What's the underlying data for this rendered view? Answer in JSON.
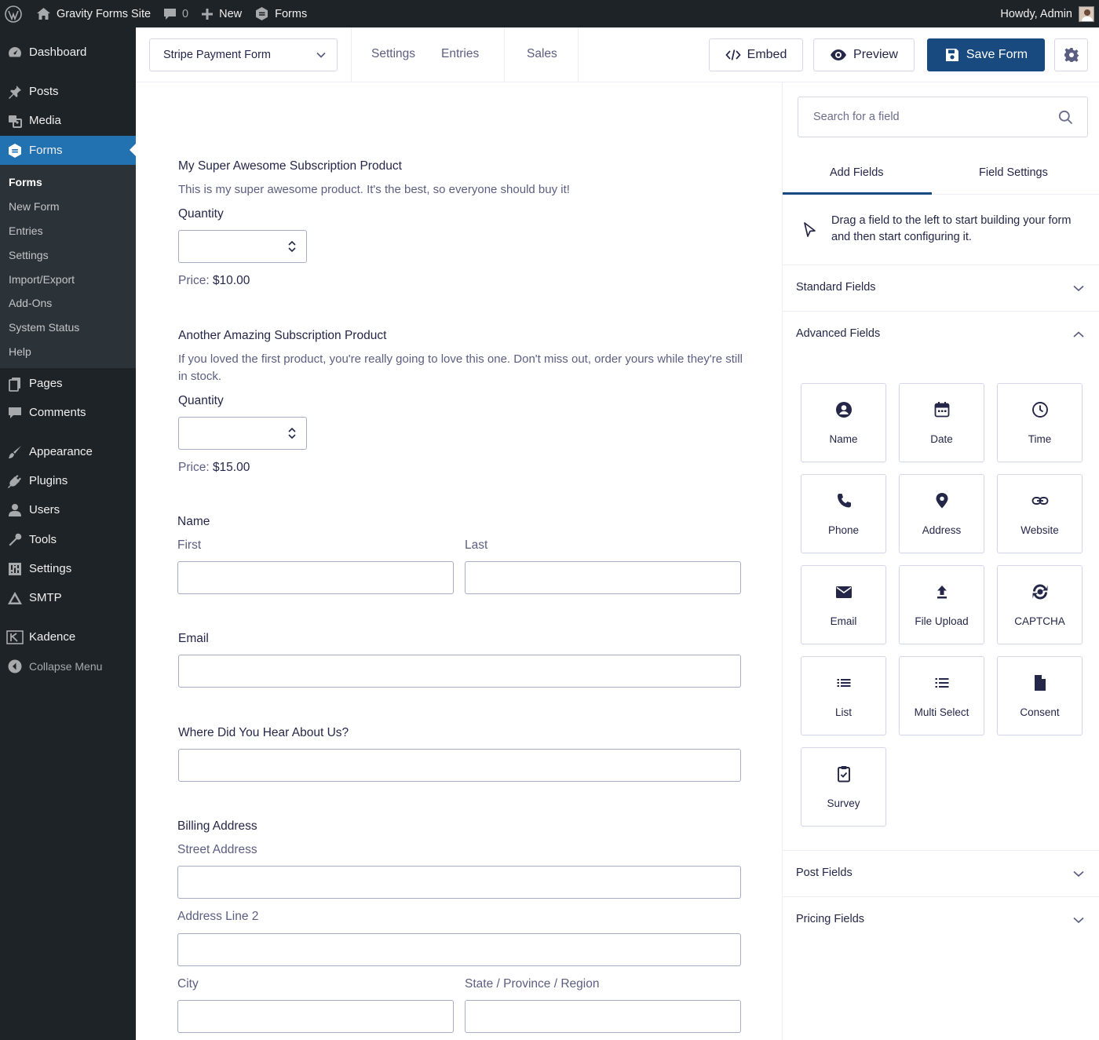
{
  "adminbar": {
    "site_name": "Gravity Forms Site",
    "comments_count": "0",
    "new_label": "New",
    "forms_label": "Forms",
    "howdy": "Howdy, Admin"
  },
  "sidebar": {
    "dashboard": "Dashboard",
    "posts": "Posts",
    "media": "Media",
    "forms": "Forms",
    "submenu": [
      "Forms",
      "New Form",
      "Entries",
      "Settings",
      "Import/Export",
      "Add-Ons",
      "System Status",
      "Help"
    ],
    "pages": "Pages",
    "comments": "Comments",
    "appearance": "Appearance",
    "plugins": "Plugins",
    "users": "Users",
    "tools": "Tools",
    "settings": "Settings",
    "smtp": "SMTP",
    "kadence": "Kadence",
    "collapse": "Collapse Menu"
  },
  "toolbar": {
    "form_name": "Stripe Payment Form",
    "settings": "Settings",
    "entries": "Entries",
    "sales": "Sales",
    "embed": "Embed",
    "preview": "Preview",
    "save": "Save Form"
  },
  "form": {
    "product1": {
      "title": "My Super Awesome Subscription Product",
      "description": "This is my super awesome product. It's the best, so everyone should buy it!",
      "quantity_label": "Quantity",
      "price_label": "Price:",
      "price": "$10.00"
    },
    "product2": {
      "title": "Another Amazing Subscription Product",
      "description": "If you loved the first product, you're really going to love this one. Don't miss out, order yours while they're still in stock.",
      "quantity_label": "Quantity",
      "price_label": "Price:",
      "price": "$15.00"
    },
    "name": {
      "label": "Name",
      "first": "First",
      "last": "Last"
    },
    "email": {
      "label": "Email"
    },
    "hear": {
      "label": "Where Did You Hear About Us?"
    },
    "billing": {
      "label": "Billing Address",
      "street": "Street Address",
      "line2": "Address Line 2",
      "city": "City",
      "state": "State / Province / Region"
    }
  },
  "panel": {
    "search_placeholder": "Search for a field",
    "tab_add": "Add Fields",
    "tab_settings": "Field Settings",
    "hint": "Drag a field to the left to start building your form and then start configuring it.",
    "standard": "Standard Fields",
    "advanced": "Advanced Fields",
    "post": "Post Fields",
    "pricing": "Pricing Fields",
    "advanced_fields": [
      {
        "label": "Name",
        "icon": "user-icon"
      },
      {
        "label": "Date",
        "icon": "calendar-icon"
      },
      {
        "label": "Time",
        "icon": "clock-icon"
      },
      {
        "label": "Phone",
        "icon": "phone-icon"
      },
      {
        "label": "Address",
        "icon": "map-pin-icon"
      },
      {
        "label": "Website",
        "icon": "link-icon"
      },
      {
        "label": "Email",
        "icon": "envelope-icon"
      },
      {
        "label": "File Upload",
        "icon": "upload-icon"
      },
      {
        "label": "CAPTCHA",
        "icon": "captcha-icon"
      },
      {
        "label": "List",
        "icon": "list-icon"
      },
      {
        "label": "Multi Select",
        "icon": "multi-select-icon"
      },
      {
        "label": "Consent",
        "icon": "document-icon"
      },
      {
        "label": "Survey",
        "icon": "clipboard-check-icon"
      }
    ]
  },
  "colors": {
    "admin_dark": "#1d2327",
    "admin_blue": "#2271b1",
    "primary_button": "#184a80",
    "text": "#242748"
  }
}
